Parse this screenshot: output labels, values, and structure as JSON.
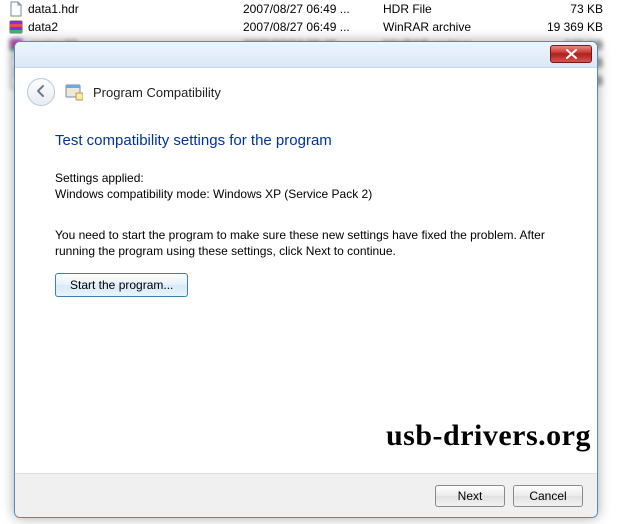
{
  "explorer": {
    "rows": [
      {
        "name": "data1.hdr",
        "date": "2007/08/27 06:49 ...",
        "type": "HDR File",
        "size": "73 KB",
        "icon": "file",
        "blur": false
      },
      {
        "name": "data2",
        "date": "2007/08/27 06:49 ...",
        "type": "WinRAR archive",
        "size": "19 369 KB",
        "icon": "rar",
        "blur": false
      },
      {
        "name": "engine23",
        "date": "2005/03/24 08:46 ...",
        "type": "WinRAR archive",
        "size": "448 KB",
        "icon": "rar",
        "blur": true
      },
      {
        "name": "installer.ipl",
        "date": "2005/06/30 12:55 ...",
        "type": "Application extens...",
        "size": "55 KB",
        "icon": "file",
        "blur": true
      },
      {
        "name": "setup",
        "date": "2005/04/03 02:03 ...",
        "type": "Application",
        "size": "51 KB",
        "icon": "file",
        "blur": true
      }
    ]
  },
  "dialog": {
    "wizard_title": "Program Compatibility",
    "close_tooltip": "Close",
    "heading": "Test compatibility settings for the program",
    "settings_label": "Settings applied:",
    "settings_value": "Windows compatibility mode: Windows XP (Service Pack 2)",
    "body": "You need to start the program to make sure these new settings have fixed the problem. After running the program using these settings, click Next to continue.",
    "start_button": "Start the program...",
    "next": "Next",
    "cancel": "Cancel"
  },
  "watermark": "usb-drivers.org",
  "icons": {
    "file": "file-icon",
    "rar": "archive-icon",
    "app": "wizard-app-icon"
  }
}
